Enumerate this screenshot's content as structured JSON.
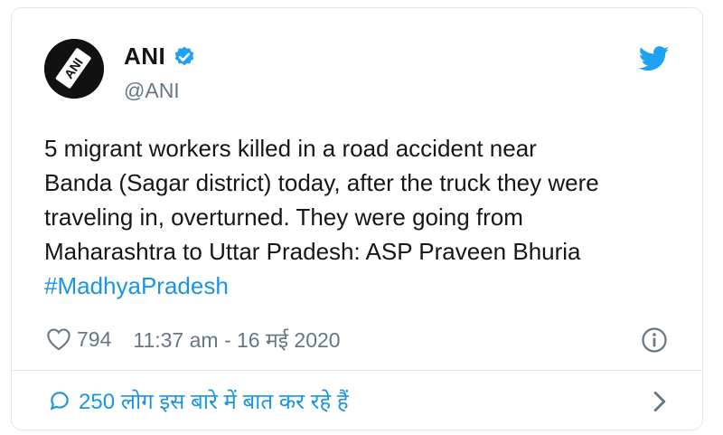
{
  "account": {
    "display_name": "ANI",
    "handle": "@ANI",
    "avatar_text": "ANI",
    "verified": true
  },
  "tweet": {
    "text_lines": [
      "5 migrant workers killed in a road accident near",
      "Banda (Sagar district) today, after the truck they were",
      "traveling in, overturned. They were going from",
      "Maharashtra to Uttar Pradesh: ASP Praveen Bhuria"
    ],
    "hashtag": "#MadhyaPradesh"
  },
  "meta": {
    "likes": "794",
    "timestamp": "11:37 am - 16 मई 2020"
  },
  "conversation": {
    "label": "250 लोग इस बारे में बात कर रहे हैं"
  },
  "colors": {
    "accent": "#1b95e0",
    "secondary_text": "#657786",
    "border": "#e1e8ed",
    "verified": "#1da1f2"
  },
  "icons": {
    "brand": "twitter-bird-icon",
    "verified": "verified-badge-icon",
    "like": "heart-icon",
    "info": "info-icon",
    "reply": "speech-bubble-icon",
    "expand": "chevron-right-icon"
  }
}
